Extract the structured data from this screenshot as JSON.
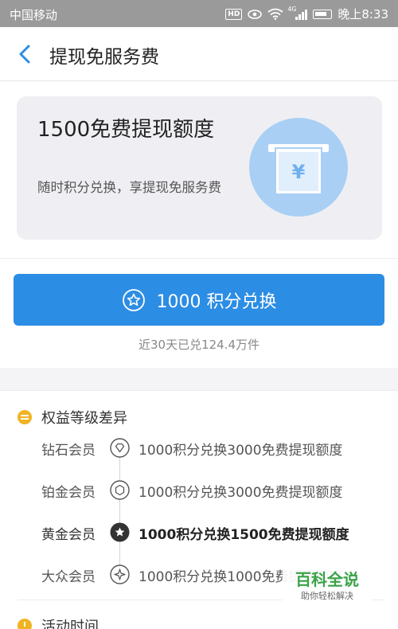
{
  "status_bar": {
    "carrier": "中国移动",
    "hd": "HD",
    "network": "4G",
    "time": "晚上8:33"
  },
  "nav": {
    "title": "提现免服务费"
  },
  "card": {
    "title": "1500免费提现额度",
    "subtitle": "随时积分兑换，享提现免服务费",
    "icon_symbol": "¥"
  },
  "exchange": {
    "button_label": "1000 积分兑换",
    "redeemed_note": "近30天已兑124.4万件"
  },
  "levels": {
    "header": "权益等级差异",
    "items": [
      {
        "name": "钻石会员",
        "desc": "1000积分兑换3000免费提现额度",
        "badge": "diamond-badge-icon"
      },
      {
        "name": "铂金会员",
        "desc": "1000积分兑换3000免费提现额度",
        "badge": "platinum-badge-icon"
      },
      {
        "name": "黄金会员",
        "desc": "1000积分兑换1500免费提现额度",
        "badge": "gold-badge-icon",
        "active": true
      },
      {
        "name": "大众会员",
        "desc": "1000积分兑换1000免费提现额度",
        "badge": "basic-badge-icon"
      }
    ]
  },
  "activity": {
    "header": "活动时间"
  },
  "watermark": {
    "main": "百科全说",
    "sub": "助你轻松解决"
  },
  "colors": {
    "primary": "#2c8de4",
    "accent": "#f0b322",
    "icon_circle": "#a9cff5",
    "watermark_green": "#3aa348"
  }
}
